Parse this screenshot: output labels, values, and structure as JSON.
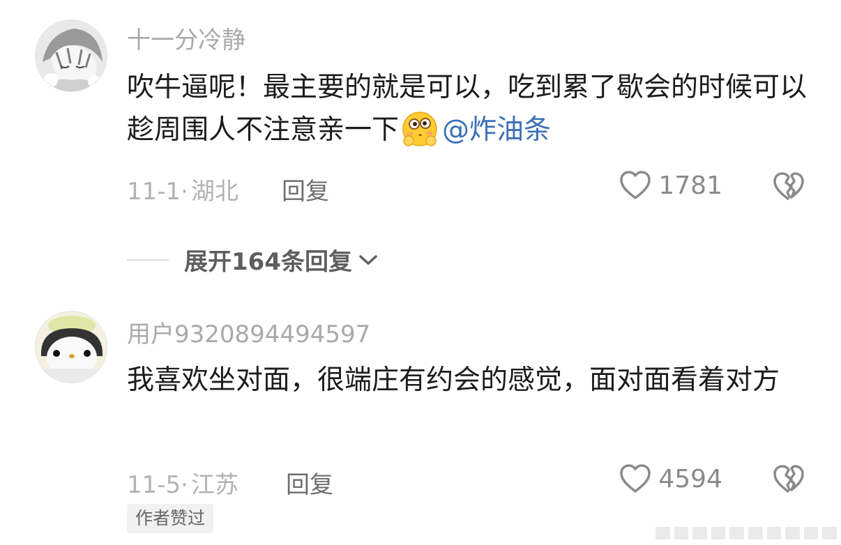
{
  "comments": [
    {
      "username": "十一分冷静",
      "content_text": "吹牛逼呢！最主要的就是可以，吃到累了歇会的时候可以趁周围人不注意亲一下",
      "emoji_icon": "shy-face-emoji-icon",
      "mention": "@炸油条",
      "date": "11-1",
      "separator": "·",
      "location": "湖北",
      "reply_label": "回复",
      "like_count": "1781",
      "avatar_icon": "anime-boy-avatar",
      "expand_label": "展开164条回复"
    },
    {
      "username": "用户9320894494597",
      "content_text": "我喜欢坐对面，很端庄有约会的感觉，面对面看着对方",
      "date": "11-5",
      "separator": "·",
      "location": "江苏",
      "reply_label": "回复",
      "like_count": "4594",
      "avatar_icon": "penguin-avatar",
      "badge": "作者赞过"
    }
  ],
  "colors": {
    "mention": "#3b6fb6",
    "username": "#a9a9a9",
    "text": "#1c1c1c"
  }
}
